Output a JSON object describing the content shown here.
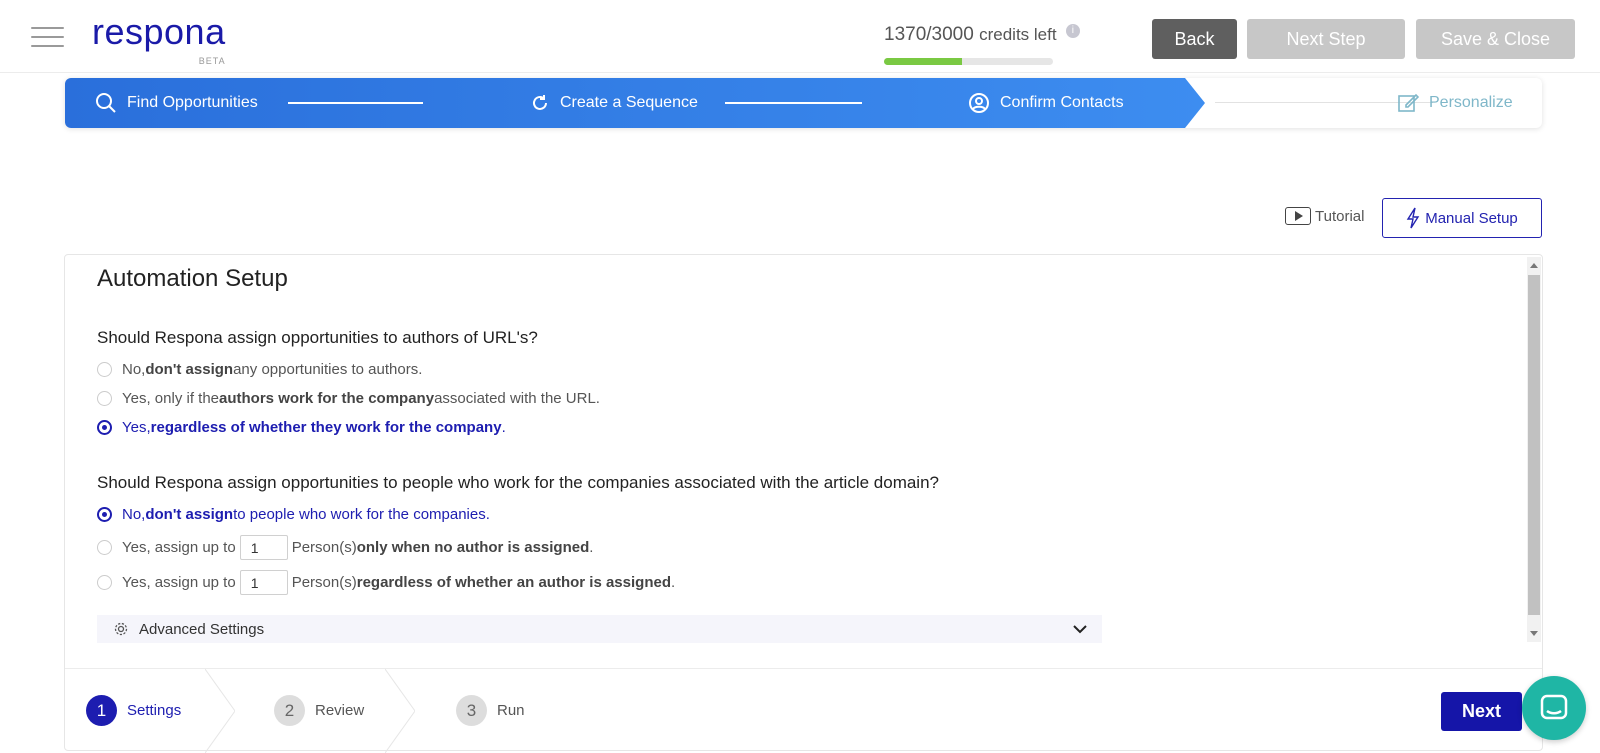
{
  "header": {
    "logo": "respona",
    "logo_badge": "BETA",
    "credits_value": "1370/3000",
    "credits_label": "credits left",
    "credits_info": "i",
    "credits_used_fraction": 0.46,
    "back_label": "Back",
    "next_step_label": "Next Step",
    "save_close_label": "Save & Close"
  },
  "wizard": {
    "steps": [
      {
        "label": "Find Opportunities",
        "icon": "search-icon"
      },
      {
        "label": "Create a Sequence",
        "icon": "refresh-icon"
      },
      {
        "label": "Confirm Contacts",
        "icon": "user-circle-icon"
      },
      {
        "label": "Personalize",
        "icon": "edit-icon"
      }
    ]
  },
  "toolbar": {
    "tutorial_label": "Tutorial",
    "manual_setup_label": "Manual Setup"
  },
  "automation": {
    "title": "Automation Setup",
    "q1": {
      "text": "Should Respona assign opportunities to authors of URL's?",
      "options": [
        {
          "pre": "No, ",
          "bold": "don't assign",
          "post": " any opportunities to authors."
        },
        {
          "pre": "Yes, only if the ",
          "bold": "authors work for the company",
          "post": " associated with the URL."
        },
        {
          "pre": "Yes, ",
          "bold": "regardless of whether they work for the company",
          "post": "."
        }
      ],
      "selected": 2
    },
    "q2": {
      "text": "Should Respona assign opportunities to people who work for the companies associated with the article domain?",
      "options": [
        {
          "pre": "No, ",
          "bold": "don't assign",
          "post": " to people who work for the companies."
        },
        {
          "pre": "Yes, assign up to",
          "input": "1",
          "mid": "Person(s) ",
          "bold": "only when no author is assigned",
          "post": "."
        },
        {
          "pre": "Yes, assign up to",
          "input": "1",
          "mid": "Person(s) ",
          "bold": "regardless of whether an author is assigned",
          "post": "."
        }
      ],
      "selected": 0
    },
    "advanced_label": "Advanced Settings"
  },
  "footer": {
    "steps": [
      {
        "num": "1",
        "label": "Settings"
      },
      {
        "num": "2",
        "label": "Review"
      },
      {
        "num": "3",
        "label": "Run"
      }
    ],
    "next_label": "Next"
  },
  "colors": {
    "brand": "#1d1db0",
    "wizard_blue": "#2a6fdb",
    "progress_green": "#7ac943",
    "chat": "#1fb6a5"
  }
}
